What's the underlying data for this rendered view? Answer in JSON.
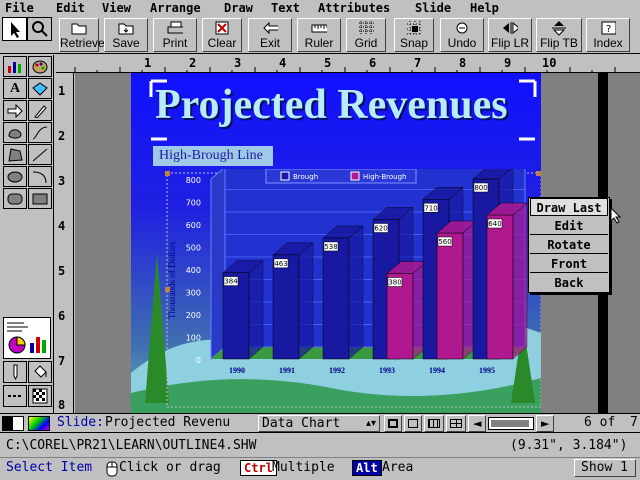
{
  "menu": [
    "File",
    "Edit",
    "View",
    "Arrange",
    "Draw",
    "Text",
    "Attributes",
    "Slide",
    "Help"
  ],
  "toolbar": {
    "buttons": [
      {
        "label": "Retrieve",
        "icon": "folder-open-icon"
      },
      {
        "label": "Save",
        "icon": "folder-save-icon"
      },
      {
        "label": "Print",
        "icon": "printer-icon"
      },
      {
        "label": "Clear",
        "icon": "clear-icon"
      },
      {
        "label": "Exit",
        "icon": "exit-icon"
      },
      {
        "label": "Ruler",
        "icon": "ruler-icon"
      },
      {
        "label": "Grid",
        "icon": "grid-icon"
      },
      {
        "label": "Snap",
        "icon": "snap-icon"
      },
      {
        "label": "Undo",
        "icon": "undo-icon"
      },
      {
        "label": "Flip LR",
        "icon": "flip-lr-icon"
      },
      {
        "label": "Flip TB",
        "icon": "flip-tb-icon"
      },
      {
        "label": "Index",
        "icon": "index-icon"
      }
    ]
  },
  "ruler": {
    "h": [
      "1",
      "2",
      "3",
      "4",
      "5",
      "6",
      "7",
      "8",
      "9",
      "10"
    ],
    "v": [
      "1",
      "2",
      "3",
      "4",
      "5",
      "6",
      "7",
      "8"
    ]
  },
  "slide": {
    "title": "Projected Revenues",
    "subtitle": "High-Brough Line"
  },
  "chart_data": {
    "type": "bar",
    "categories": [
      "1990",
      "1991",
      "1992",
      "1993",
      "1994",
      "1995"
    ],
    "series": [
      {
        "name": "Brough",
        "values": [
          384,
          463,
          538,
          620,
          710,
          800
        ],
        "color": "#1818a0"
      },
      {
        "name": "High-Brough",
        "values": [
          null,
          null,
          null,
          380,
          560,
          640
        ],
        "color": "#b01890"
      }
    ],
    "ylabel": "Thousands of Dollars",
    "yticks": [
      "0",
      "100",
      "200",
      "300",
      "400",
      "500",
      "600",
      "700",
      "800"
    ],
    "ylim": [
      0,
      800
    ],
    "legend": "top"
  },
  "context_menu": [
    "Draw Last",
    "Edit",
    "Rotate",
    "Front",
    "Back"
  ],
  "bottom": {
    "slide_label": "Slide:",
    "slide_name": "Projected Revenu",
    "chart_select": "Data Chart",
    "page_of": "6 of",
    "page_total": "7"
  },
  "status": {
    "path": "C:\\COREL\\PR21\\LEARN\\OUTLINE4.SHW",
    "coords": "(9.31\", 3.184\")",
    "mode": "Select Item",
    "hint_click": "Click or drag",
    "key_ctrl": "Ctrl",
    "hint_multiple": "Multiple",
    "key_alt": "Alt",
    "hint_area": "Area",
    "show_button": "Show 1"
  }
}
